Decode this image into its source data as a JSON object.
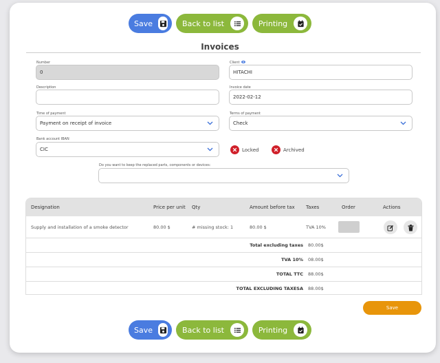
{
  "toolbar": {
    "save_label": "Save",
    "back_label": "Back to list",
    "print_label": "Printing"
  },
  "page_title": "Invoices",
  "form": {
    "number": {
      "label": "Number",
      "value": "0"
    },
    "client": {
      "label": "Client",
      "value": "HITACHI"
    },
    "description": {
      "label": "Description",
      "value": ""
    },
    "invoice_date": {
      "label": "Invoice date",
      "value": "2022-02-12"
    },
    "time_of_payment": {
      "label": "Time of payment",
      "value": "Payment on receipt of invoice"
    },
    "terms_of_payment": {
      "label": "Terms of payment",
      "value": "Check"
    },
    "bank_account": {
      "label": "Bank account IBAN",
      "value": "CIC"
    },
    "locked_label": "Locked",
    "archived_label": "Archived",
    "replaced_parts": {
      "label": "Do you want to keep the replaced parts, components or devices:",
      "value": ""
    }
  },
  "table": {
    "headers": [
      "Designation",
      "Price per unit",
      "Qty",
      "Amount before tax",
      "Taxes",
      "Order",
      "Actions"
    ],
    "rows": [
      {
        "designation": "Supply and installation of a smoke detector",
        "price": "80.00 $",
        "qty": "# missing stock: 1",
        "amount": "80.00 $",
        "taxes": "TVA 10%"
      }
    ],
    "totals": [
      {
        "label": "Total excluding taxes",
        "value": "80.00$"
      },
      {
        "label": "TVA 10%",
        "value": "08.00$"
      },
      {
        "label": "TOTAL TTC",
        "value": "88.00$"
      },
      {
        "label": "TOTAL EXCLUDING TAXESA",
        "value": "88.00$"
      }
    ]
  },
  "save_button_label": "Save",
  "colors": {
    "save_blue": "#4a7ce0",
    "action_green": "#8cb83c",
    "orange_save": "#e8950a",
    "status_red": "#d0202a"
  },
  "icons": {
    "save": "floppy-disk-icon",
    "back": "list-icon",
    "print": "calendar-check-icon",
    "edit": "edit-icon",
    "delete": "trash-icon",
    "eye": "eye-icon"
  }
}
